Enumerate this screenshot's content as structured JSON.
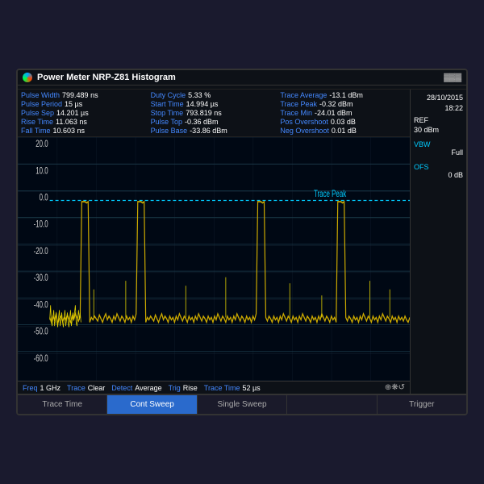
{
  "title": {
    "text": "Power Meter NRP-Z81 Histogram",
    "battery": "▓▓▓"
  },
  "info": {
    "col1": [
      {
        "label": "Pulse Width",
        "value": "799.489 ns"
      },
      {
        "label": "Pulse Period",
        "value": "15 µs"
      },
      {
        "label": "Pulse Sep",
        "value": "14.201 µs"
      },
      {
        "label": "Rise Time",
        "value": "11.063 ns"
      },
      {
        "label": "Fall Time",
        "value": "10.603 ns"
      }
    ],
    "col2": [
      {
        "label": "Duty Cycle",
        "value": "5.33 %"
      },
      {
        "label": "Start Time",
        "value": "14.994 µs"
      },
      {
        "label": "Stop Time",
        "value": "793.819 ns"
      },
      {
        "label": "Pulse Top",
        "value": "-0.36 dBm"
      },
      {
        "label": "Pulse Base",
        "value": "-33.86 dBm"
      }
    ],
    "col3": [
      {
        "label": "Trace Average",
        "value": "-13.1 dBm"
      },
      {
        "label": "Trace Peak",
        "value": "-0.32 dBm"
      },
      {
        "label": "Trace Min",
        "value": "-24.01 dBm"
      },
      {
        "label": "Pos Overshoot",
        "value": "0.03 dB"
      },
      {
        "label": "Neg Overshoot",
        "value": "0.01 dB"
      }
    ]
  },
  "right_panel": {
    "date": "28/10/2015",
    "time": "18:22",
    "ref_label": "REF",
    "ref_value": "30 dBm",
    "vbw_label": "VBW",
    "vbw_value": "Full",
    "ofs_label": "OFS",
    "ofs_value": "0 dB"
  },
  "y_axis": {
    "labels": [
      "20.0",
      "10.0",
      "0.0",
      "-10.0",
      "-20.0",
      "-30.0",
      "-40.0",
      "-50.0",
      "-60.0"
    ]
  },
  "status_bar": {
    "freq_label": "Freq",
    "freq_value": "1 GHz",
    "trace_label": "Trace",
    "trace_value": "Clear",
    "detect_label": "Detect",
    "detect_value": "Average",
    "trig_label": "Trig",
    "trig_value": "Rise",
    "trace_time_label": "Trace Time",
    "trace_time_value": "52 µs"
  },
  "tabs": [
    {
      "label": "Trace Time",
      "active": false
    },
    {
      "label": "Cont Sweep",
      "active": true
    },
    {
      "label": "Single Sweep",
      "active": false
    },
    {
      "label": "",
      "active": false
    },
    {
      "label": "Trigger",
      "active": false
    }
  ],
  "trace_peak_label": "Trace Peak"
}
